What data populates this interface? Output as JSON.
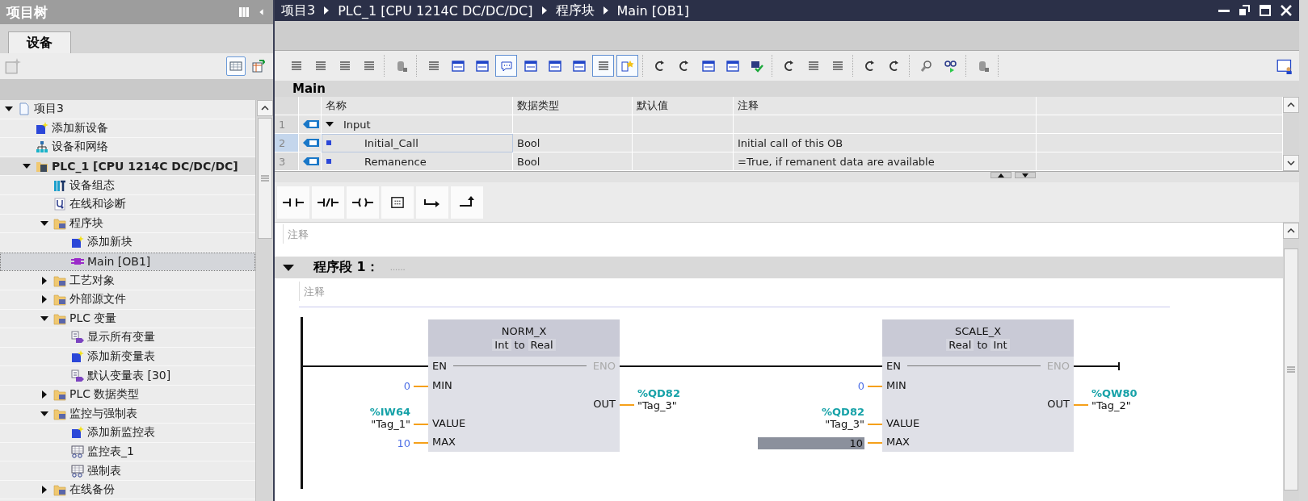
{
  "project_tree": {
    "title": "项目树",
    "tabs": [
      {
        "label": "设备",
        "selected": true
      }
    ],
    "view_buttons": [
      {
        "pressed": true
      },
      {
        "pressed": false
      }
    ],
    "items": [
      {
        "label": "项目3",
        "kind": "project",
        "expanded": true,
        "selected": false,
        "children": [
          {
            "label": "添加新设备",
            "kind": "add",
            "selected": false
          },
          {
            "label": "设备和网络",
            "kind": "network",
            "selected": false
          },
          {
            "label": "PLC_1 [CPU 1214C DC/DC/DC]",
            "kind": "device",
            "expanded": true,
            "selected": false,
            "children": [
              {
                "label": "设备组态",
                "kind": "config",
                "selected": false
              },
              {
                "label": "在线和诊断",
                "kind": "diagnostics",
                "selected": false
              },
              {
                "label": "程序块",
                "kind": "folder",
                "expanded": true,
                "selected": false,
                "children": [
                  {
                    "label": "添加新块",
                    "kind": "add",
                    "selected": false
                  },
                  {
                    "label": "Main [OB1]",
                    "kind": "block",
                    "selected": true
                  }
                ]
              },
              {
                "label": "工艺对象",
                "kind": "folder",
                "expanded": false,
                "selected": false
              },
              {
                "label": "外部源文件",
                "kind": "folder",
                "expanded": false,
                "selected": false
              },
              {
                "label": "PLC 变量",
                "kind": "folder",
                "expanded": true,
                "selected": false,
                "children": [
                  {
                    "label": "显示所有变量",
                    "kind": "tags",
                    "selected": false
                  },
                  {
                    "label": "添加新变量表",
                    "kind": "add",
                    "selected": false
                  },
                  {
                    "label": "默认变量表 [30]",
                    "kind": "tags",
                    "selected": false
                  }
                ]
              },
              {
                "label": "PLC 数据类型",
                "kind": "folder",
                "expanded": false,
                "selected": false
              },
              {
                "label": "监控与强制表",
                "kind": "folder",
                "expanded": true,
                "selected": false,
                "children": [
                  {
                    "label": "添加新监控表",
                    "kind": "add",
                    "selected": false
                  },
                  {
                    "label": "监控表_1",
                    "kind": "watch",
                    "selected": false
                  },
                  {
                    "label": "强制表",
                    "kind": "watch",
                    "selected": false
                  }
                ]
              },
              {
                "label": "在线备份",
                "kind": "folder",
                "expanded": false,
                "selected": false
              }
            ]
          }
        ]
      }
    ]
  },
  "editor": {
    "breadcrumb": [
      "项目3",
      "PLC_1 [CPU 1214C DC/DC/DC]",
      "程序块",
      "Main [OB1]"
    ],
    "toolbar": [
      [
        {
          "pressed": false
        },
        {
          "pressed": false
        },
        {
          "pressed": false
        },
        {
          "pressed": false
        }
      ],
      [
        {
          "pressed": false
        }
      ],
      [
        {
          "pressed": false
        },
        {
          "pressed": false
        },
        {
          "pressed": false
        },
        {
          "pressed": true
        },
        {
          "pressed": false
        },
        {
          "pressed": false
        },
        {
          "pressed": false
        },
        {
          "pressed": true
        },
        {
          "pressed": true
        }
      ],
      [
        {
          "pressed": false
        },
        {
          "pressed": false
        },
        {
          "pressed": false
        },
        {
          "pressed": false
        },
        {
          "pressed": false
        }
      ],
      [
        {
          "pressed": false
        },
        {
          "pressed": false
        },
        {
          "pressed": false
        }
      ],
      [
        {
          "pressed": false
        },
        {
          "pressed": false
        }
      ],
      [
        {
          "pressed": false
        },
        {
          "pressed": false
        }
      ],
      [
        {
          "pressed": false
        }
      ]
    ],
    "block_name": "Main",
    "interface": {
      "columns": [
        "名称",
        "数据类型",
        "默认值",
        "注释"
      ],
      "rows": [
        {
          "number": "1",
          "name": "Input",
          "kind": "section",
          "expanded": true,
          "selected": false
        },
        {
          "number": "2",
          "name": "Initial_Call",
          "data_type": "Bool",
          "comment": "Initial call of this OB",
          "kind": "variable",
          "selected": true
        },
        {
          "number": "3",
          "name": "Remanence",
          "data_type": "Bool",
          "comment": "=True, if remanent data are available",
          "kind": "variable",
          "selected": false
        }
      ]
    },
    "block_comment": {
      "placeholder": "注释"
    },
    "network": {
      "title": "程序段 1：",
      "title_hint": "......",
      "expanded": true,
      "comment": {
        "placeholder": "注释"
      },
      "blocks": [
        {
          "name": "NORM_X",
          "from_type": "Int",
          "to_word": "to",
          "to_type": "Real",
          "en": "EN",
          "eno": "ENO",
          "inputs": [
            {
              "pin": "MIN",
              "kind": "constant",
              "value": "0",
              "selected": false
            },
            {
              "pin": "VALUE",
              "kind": "tag",
              "address": "%IW64",
              "tag": "\"Tag_1\"",
              "selected": false
            },
            {
              "pin": "MAX",
              "kind": "constant",
              "value": "10",
              "selected": false
            }
          ],
          "outputs": [
            {
              "pin": "OUT",
              "address": "%QD82",
              "tag": "\"Tag_3\""
            }
          ]
        },
        {
          "name": "SCALE_X",
          "from_type": "Real",
          "to_word": "to",
          "to_type": "Int",
          "en": "EN",
          "eno": "ENO",
          "inputs": [
            {
              "pin": "MIN",
              "kind": "constant",
              "value": "0",
              "selected": false
            },
            {
              "pin": "VALUE",
              "kind": "tag",
              "address": "%QD82",
              "tag": "\"Tag_3\"",
              "selected": false
            },
            {
              "pin": "MAX",
              "kind": "constant",
              "value": "10",
              "selected": true
            }
          ],
          "outputs": [
            {
              "pin": "OUT",
              "address": "%QW80",
              "tag": "\"Tag_2\""
            }
          ]
        }
      ]
    }
  }
}
